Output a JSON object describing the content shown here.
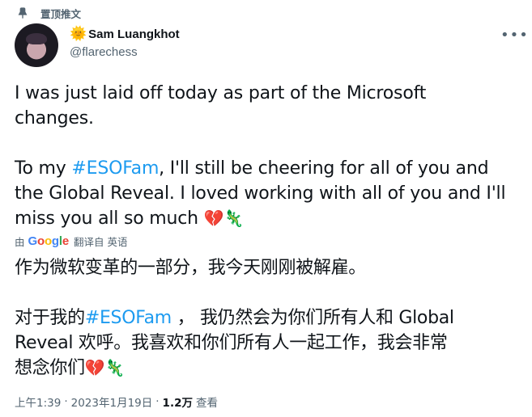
{
  "pinned": {
    "label": "置顶推文"
  },
  "author": {
    "display_name": "Sam Luangkhot",
    "handle": "@flarechess",
    "name_emoji": "🌞"
  },
  "tweet": {
    "segments": [
      {
        "text": "I was just laid off today as part of the Microsoft\nchanges.\n\nTo my "
      },
      {
        "text": "#ESOFam",
        "hashtag": true
      },
      {
        "text": ", I'll still be cheering for all of you and\nthe Global Reveal. I loved working with all of you and I'll\nmiss you all so much "
      }
    ],
    "emojis": [
      "💔",
      "🦎"
    ]
  },
  "translation": {
    "by_label": "由",
    "google_logo": "Google",
    "action_label": "翻译自 英语",
    "segments": [
      {
        "text": "作为微软变革的一部分，我今天刚刚被解雇。\n\n对于我的"
      },
      {
        "text": "#ESOFam",
        "hashtag": true
      },
      {
        "text": " ， 我仍然会为你们所有人和 Global\nReveal 欢呼。我喜欢和你们所有人一起工作，我会非常\n想念你们"
      }
    ],
    "emojis": [
      "💔",
      "🦎"
    ]
  },
  "meta": {
    "time": "上午1:39",
    "date": "2023年1月19日",
    "views_count": "1.2万",
    "views_label": "查看"
  },
  "colors": {
    "hashtag": "#1d9bf0",
    "secondary_text": "#536471",
    "primary_text": "#0f1419"
  }
}
